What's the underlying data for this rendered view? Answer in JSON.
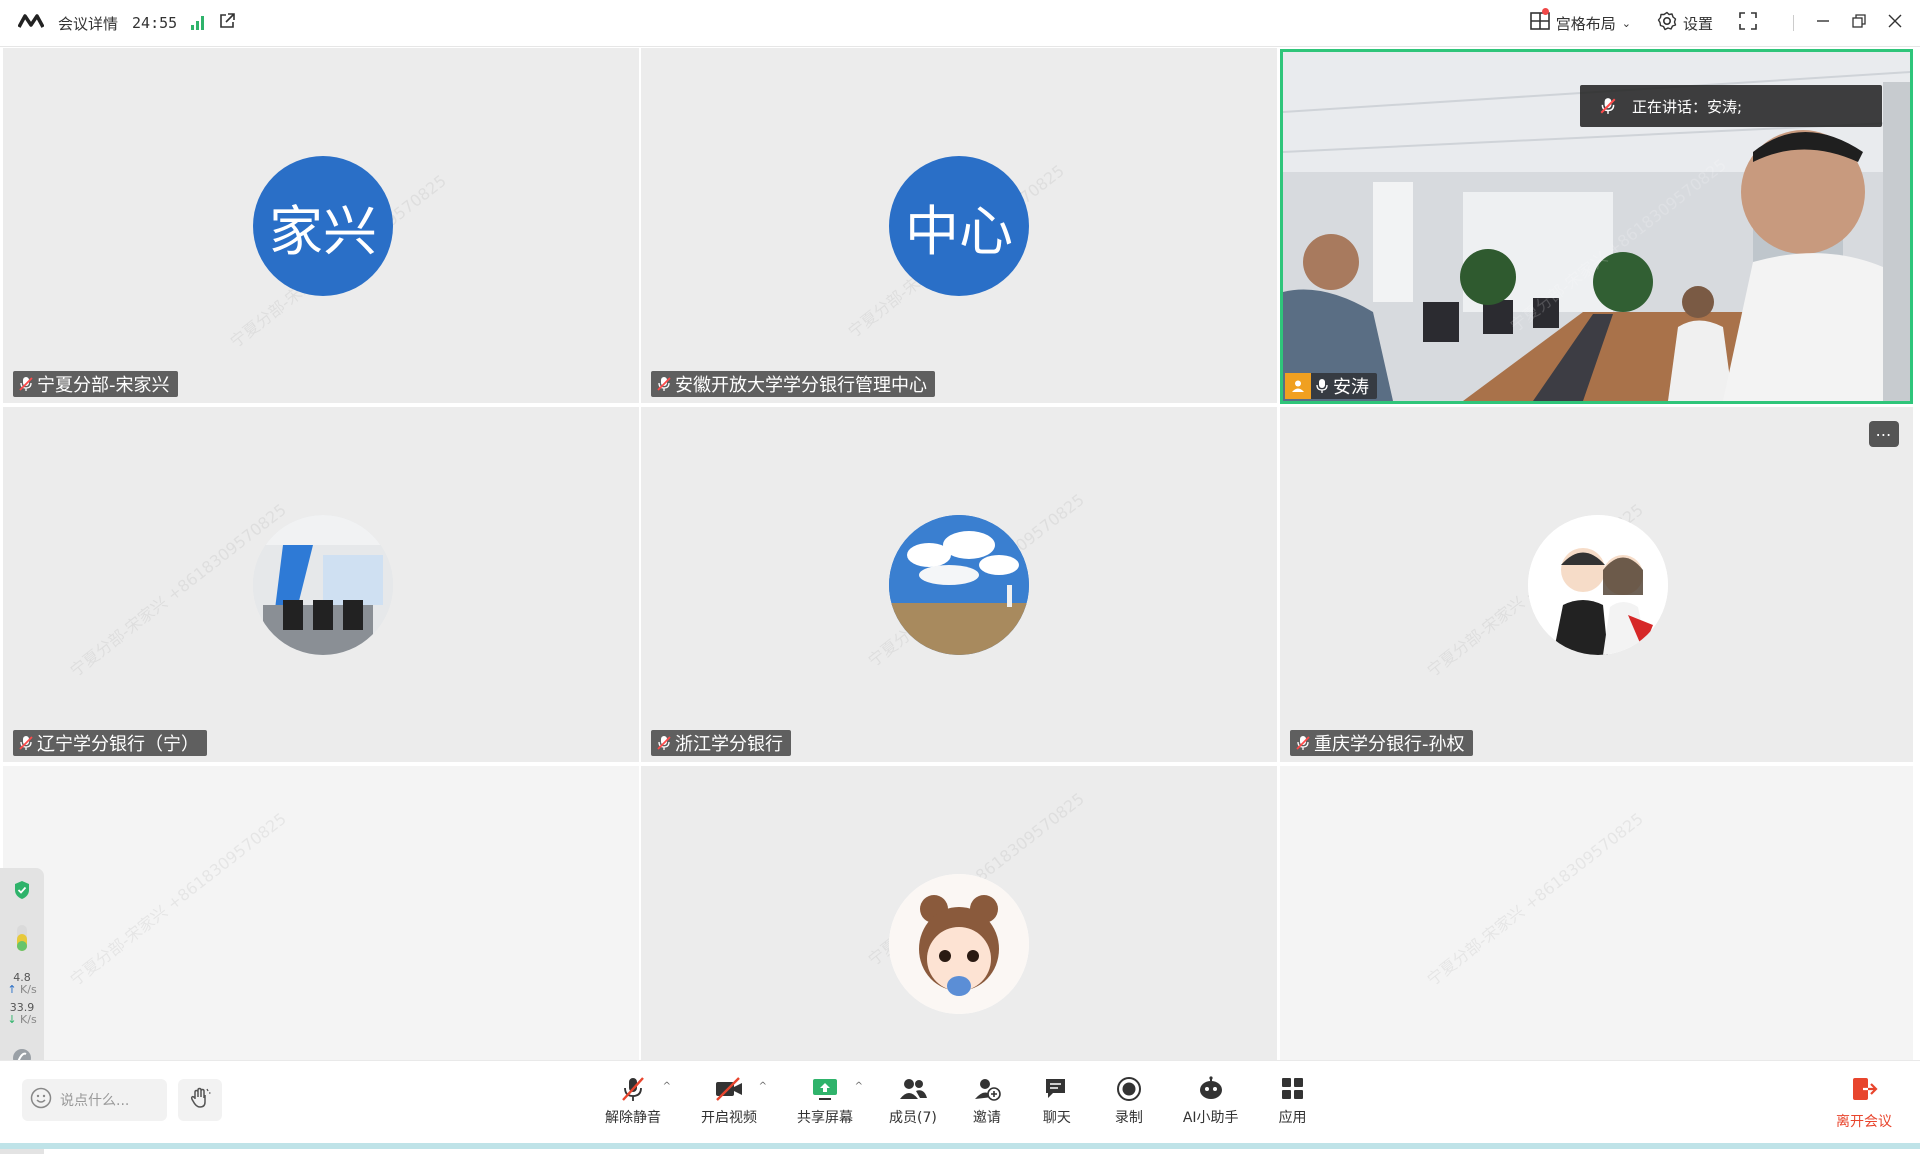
{
  "titlebar": {
    "title": "会议详情",
    "timer": "24:55",
    "layout_label": "宫格布局",
    "settings_label": "设置"
  },
  "tiles": [
    {
      "name": "宁夏分部-宋家兴",
      "avatar_text": "家兴"
    },
    {
      "name": "安徽开放大学学分银行管理中心",
      "avatar_text": "中心"
    },
    {
      "name": "安涛",
      "speaking": true
    },
    {
      "name": "辽宁学分银行（宁）"
    },
    {
      "name": "浙江学分银行"
    },
    {
      "name": "重庆学分银行-孙权"
    }
  ],
  "speaking_banner": "正在讲话：安涛;",
  "watermark": "宁夏分部-宋家兴 +8618309570825",
  "side_panel": {
    "up_speed": "4.8",
    "up_unit": "K/s",
    "down_speed": "33.9",
    "down_unit": "K/s"
  },
  "toolbar": {
    "chat_placeholder": "说点什么...",
    "unmute": "解除静音",
    "start_video": "开启视频",
    "share_screen": "共享屏幕",
    "members": "成员(7)",
    "invite": "邀请",
    "chat": "聊天",
    "record": "录制",
    "ai_assistant": "AI小助手",
    "apps": "应用",
    "leave": "离开会议"
  },
  "colors": {
    "avatar_blue": "#2a6fc7",
    "speaking_border": "#2fc57a",
    "leave_red": "#e8452d",
    "signal_green": "#2fb36b"
  }
}
